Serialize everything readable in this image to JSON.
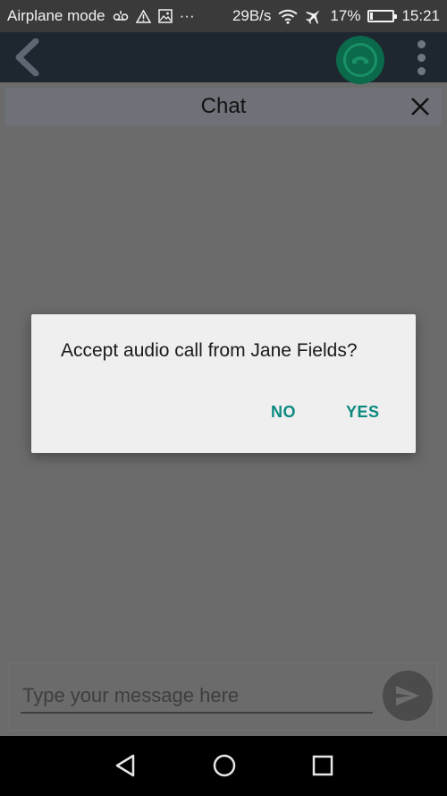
{
  "status_bar": {
    "mode_label": "Airplane mode",
    "overflow_dots": "···",
    "net_speed": "29B/s",
    "battery_percent": "17%",
    "battery_level": 0.17,
    "time": "15:21",
    "icons": [
      "voicemail-icon",
      "warning-icon",
      "image-icon",
      "wifi-icon",
      "airplane-icon",
      "battery-icon"
    ]
  },
  "toolbar": {
    "icons": [
      "back-arrow-icon",
      "hang-up-icon",
      "more-vertical-icon"
    ],
    "call_button_color": "#0b6a4b"
  },
  "chat": {
    "title": "Chat"
  },
  "dialog": {
    "message": "Accept audio call from Jane Fields?",
    "no_label": "NO",
    "yes_label": "YES",
    "button_color": "#0c8a80"
  },
  "composer": {
    "placeholder": "Type your message here",
    "value": ""
  },
  "nav_bar": {
    "icons": [
      "back-triangle-icon",
      "home-circle-icon",
      "recents-square-icon"
    ]
  }
}
